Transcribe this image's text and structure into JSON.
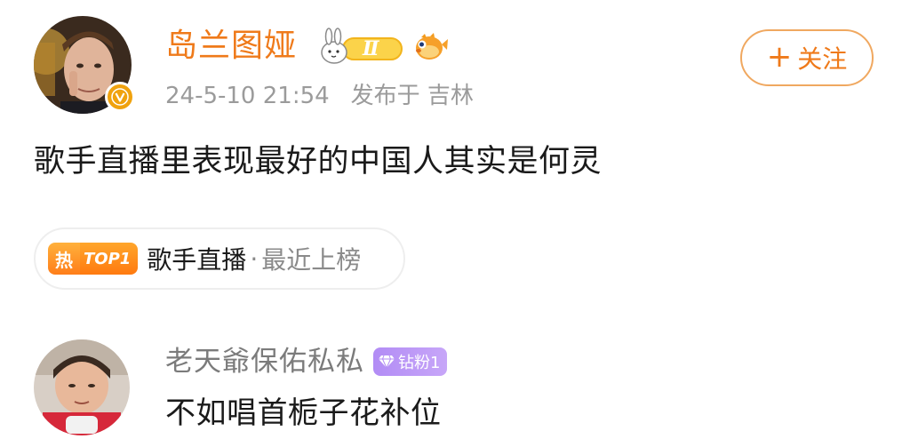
{
  "post": {
    "username": "岛兰图娅",
    "level_badge": "Ⅱ",
    "timestamp": "24-5-10 21:54",
    "published_from": "发布于 吉林",
    "follow_label": "关注",
    "follow_plus": "+",
    "verified_mark": "V",
    "text": "歌手直播里表现最好的中国人其实是何灵"
  },
  "topic": {
    "hot_label": "热",
    "rank_label": "TOP1",
    "name": "歌手直播",
    "separator": "·",
    "status": "最近上榜"
  },
  "comment": {
    "username": "老天爺保佑私私",
    "fan_badge": "钻粉1",
    "text": "不如唱首栀子花补位"
  },
  "colors": {
    "accent_orange": "#ef7a1a",
    "meta_gray": "#9b9b9b",
    "fan_badge_purple": "#b28cf5",
    "verified_gold": "#f0a20e"
  },
  "icons": {
    "verified": "verified-v-icon",
    "rank_badge": "rabbit-rank-badge-icon",
    "fish_badge": "pufferfish-badge-icon",
    "hot": "hot-fire-icon",
    "gem": "diamond-gem-icon"
  }
}
